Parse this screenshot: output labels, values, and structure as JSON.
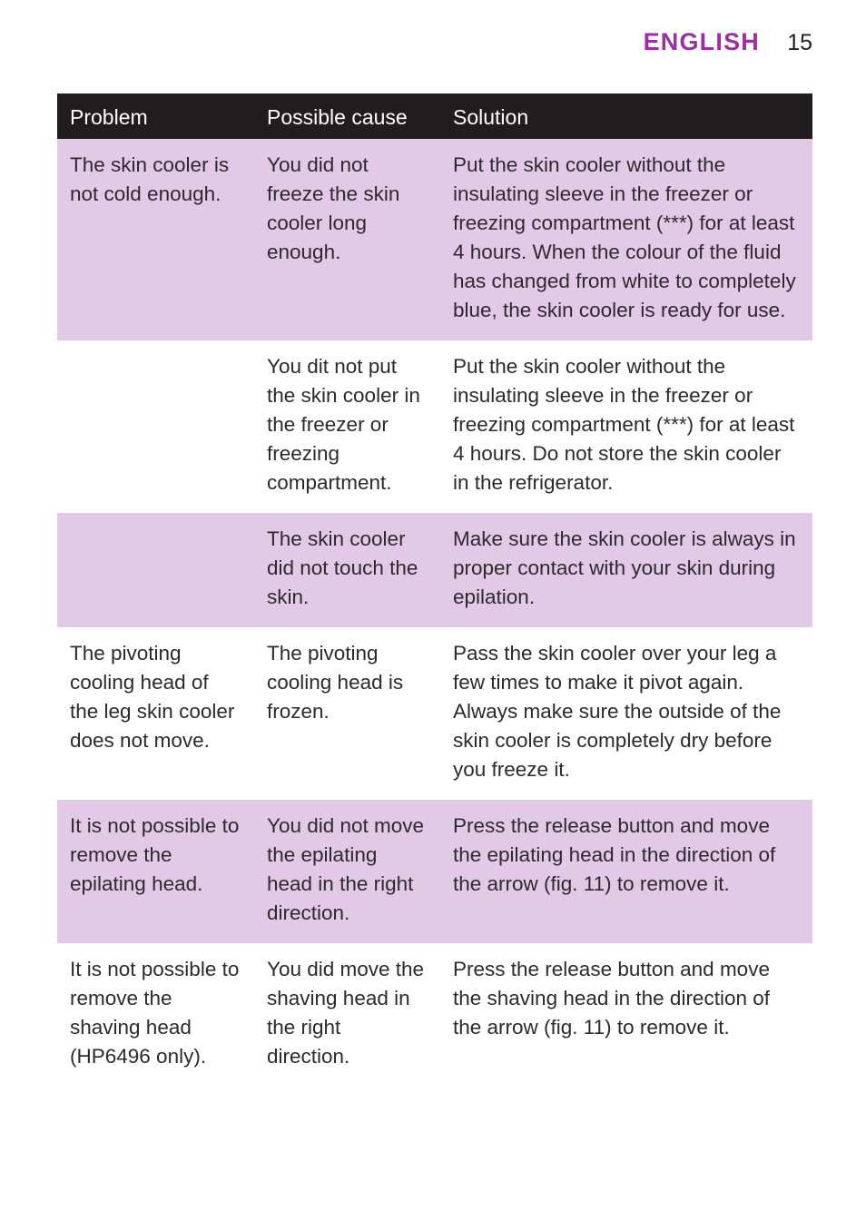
{
  "running_head": {
    "language": "ENGLISH",
    "page_number": "15",
    "accent_color": "#9d2fa4"
  },
  "table": {
    "header_background": "#211d1e",
    "tint_color": "#e1c9e7",
    "columns": [
      {
        "key": "problem",
        "label": "Problem"
      },
      {
        "key": "cause",
        "label": "Possible cause"
      },
      {
        "key": "solution",
        "label": "Solution"
      }
    ],
    "rows": [
      {
        "tint": true,
        "problem": "The skin cooler is not cold enough.",
        "cause": "You did not freeze the skin cooler long enough.",
        "solution": "Put the skin cooler without the insulating sleeve in the freezer or freezing compartment (***) for at least 4 hours. When the colour of the fluid has changed from white to completely blue, the skin cooler is ready for use."
      },
      {
        "tint": false,
        "problem": "",
        "cause": "You dit not put the skin cooler in the freezer or freezing compartment.",
        "solution": "Put the skin cooler without the insulating sleeve in the freezer or freezing compartment (***) for at least 4 hours. Do not store the skin cooler in the refrigerator."
      },
      {
        "tint": true,
        "problem": "",
        "cause": "The skin cooler did not touch the skin.",
        "solution": "Make sure the skin cooler is always in proper contact with your skin during epilation."
      },
      {
        "tint": false,
        "problem": "The pivoting cooling head of the leg skin cooler does not move.",
        "cause": "The pivoting cooling head is frozen.",
        "solution": "Pass the skin cooler over your leg a few times to make it pivot again. Always make sure the outside of the skin cooler is completely dry before you freeze it."
      },
      {
        "tint": true,
        "problem": "It is not possible to remove the epilating head.",
        "cause": "You did not move the epilating head in the right direction.",
        "solution": "Press the release button and move the epilating head in the direction of the arrow (fig. 11) to remove it."
      },
      {
        "tint": false,
        "problem": "It is not possible to remove the shaving head (HP6496 only).",
        "cause": "You did move the shaving head in the right direction.",
        "solution": "Press the release button and move the shaving head in the direction of the arrow (fig. 11) to remove it."
      }
    ]
  }
}
